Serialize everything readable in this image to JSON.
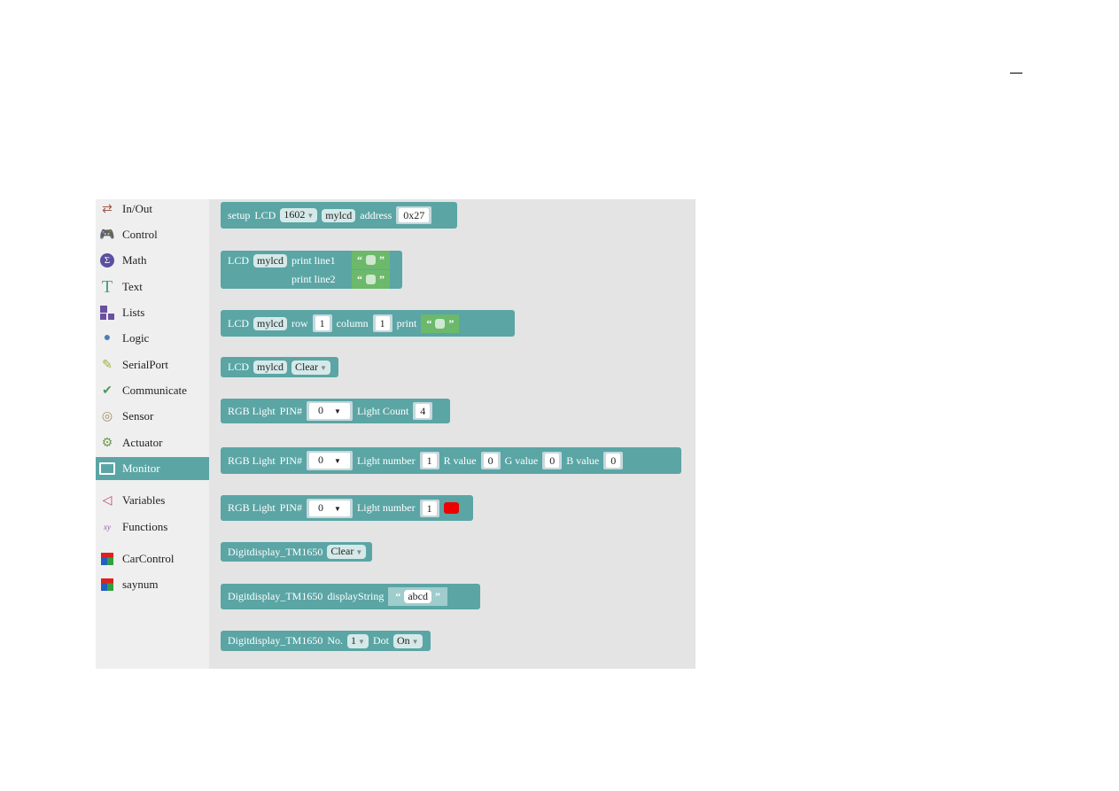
{
  "sidebar": {
    "items": [
      {
        "label": "In/Out",
        "icon": "arrows-icon",
        "color": "#a05a4a"
      },
      {
        "label": "Control",
        "icon": "gamepad-icon",
        "color": "#5a9a5a"
      },
      {
        "label": "Math",
        "icon": "math-icon",
        "color": "#5a50a0"
      },
      {
        "label": "Text",
        "icon": "text-icon",
        "color": "#4a9a8a"
      },
      {
        "label": "Lists",
        "icon": "lists-icon",
        "color": "#6a50a0"
      },
      {
        "label": "Logic",
        "icon": "bulb-icon",
        "color": "#4a80b0"
      },
      {
        "label": "SerialPort",
        "icon": "usb-icon",
        "color": "#9ab040"
      },
      {
        "label": "Communicate",
        "icon": "antenna-icon",
        "color": "#4a9a5a"
      },
      {
        "label": "Sensor",
        "icon": "sensor-icon",
        "color": "#a09060"
      },
      {
        "label": "Actuator",
        "icon": "actuator-icon",
        "color": "#6a9a4a"
      },
      {
        "label": "Monitor",
        "icon": "monitor-icon",
        "selected": true
      },
      {
        "label": "Variables",
        "icon": "variables-icon",
        "color": "#c04060"
      },
      {
        "label": "Functions",
        "icon": "functions-icon",
        "color": "#9060a0"
      },
      {
        "label": "CarControl",
        "icon": "cube-icon"
      },
      {
        "label": "saynum",
        "icon": "cube-icon"
      }
    ]
  },
  "blocks": {
    "setup": {
      "t1": "setup",
      "t2": "LCD",
      "model": "1602",
      "name": "mylcd",
      "t3": "address",
      "addr": "0x27"
    },
    "print": {
      "t1": "LCD",
      "name": "mylcd",
      "l1": "print line1",
      "l2": "print line2"
    },
    "pos": {
      "t1": "LCD",
      "name": "mylcd",
      "row": "row",
      "rv": "1",
      "col": "column",
      "cv": "1",
      "print": "print"
    },
    "clear": {
      "t1": "LCD",
      "name": "mylcd",
      "opt": "Clear"
    },
    "rgbcount": {
      "t1": "RGB Light",
      "pin": "PIN#",
      "pv": "0",
      "count": "Light Count",
      "cv": "4"
    },
    "rgbfull": {
      "t1": "RGB Light",
      "pin": "PIN#",
      "pv": "0",
      "num": "Light number",
      "nv": "1",
      "r": "R value",
      "rv": "0",
      "g": "G value",
      "gv": "0",
      "b": "B value",
      "bv": "0"
    },
    "rgbcolor": {
      "t1": "RGB Light",
      "pin": "PIN#",
      "pv": "0",
      "num": "Light number",
      "nv": "1",
      "color": "#ee0000"
    },
    "dclear": {
      "t1": "Digitdisplay_TM1650",
      "opt": "Clear"
    },
    "dstr": {
      "t1": "Digitdisplay_TM1650",
      "t2": "displayString",
      "val": "abcd"
    },
    "ddot": {
      "t1": "Digitdisplay_TM1650",
      "no": "No.",
      "nv": "1",
      "dot": "Dot",
      "dv": "On"
    }
  },
  "colors": {
    "block": "#5ba5a5",
    "text_block": "#6cb96c"
  }
}
